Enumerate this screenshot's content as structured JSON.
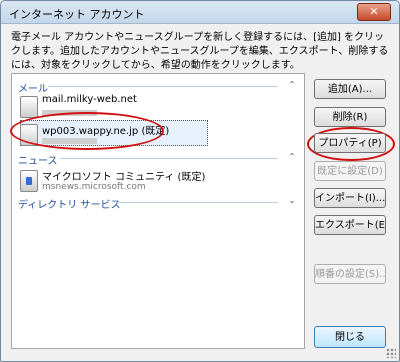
{
  "window": {
    "title": "インターネット アカウント",
    "close_glyph": "✕"
  },
  "description": "電子メール アカウントやニュースグループを新しく登録するには、[追加] をクリックします。追加したアカウントやニュースグループを編集、エクスポート、削除するには、対象をクリックしてから、希望の動作をクリックします。",
  "sections": {
    "mail": "メール",
    "news": "ニュース",
    "directory": "ディレクトリ サービス"
  },
  "accounts": {
    "mail1": {
      "name": "mail.milky-web.net"
    },
    "mail2": {
      "name": "wp003.wappy.ne.jp (既定)"
    },
    "news1": {
      "name": "マイクロソフト コミュニティ (既定)",
      "server": "msnews.microsoft.com"
    }
  },
  "buttons": {
    "add": "追加(A)...",
    "remove": "削除(R)",
    "properties": "プロパティ(P)",
    "set_default": "既定に設定(D)",
    "import": "インポート(I)...",
    "export": "エクスポート(E)...",
    "order": "順番の設定(S)...",
    "close": "閉じる"
  },
  "colors": {
    "annotation": "#d01010",
    "section_text": "#1e4fa0"
  }
}
